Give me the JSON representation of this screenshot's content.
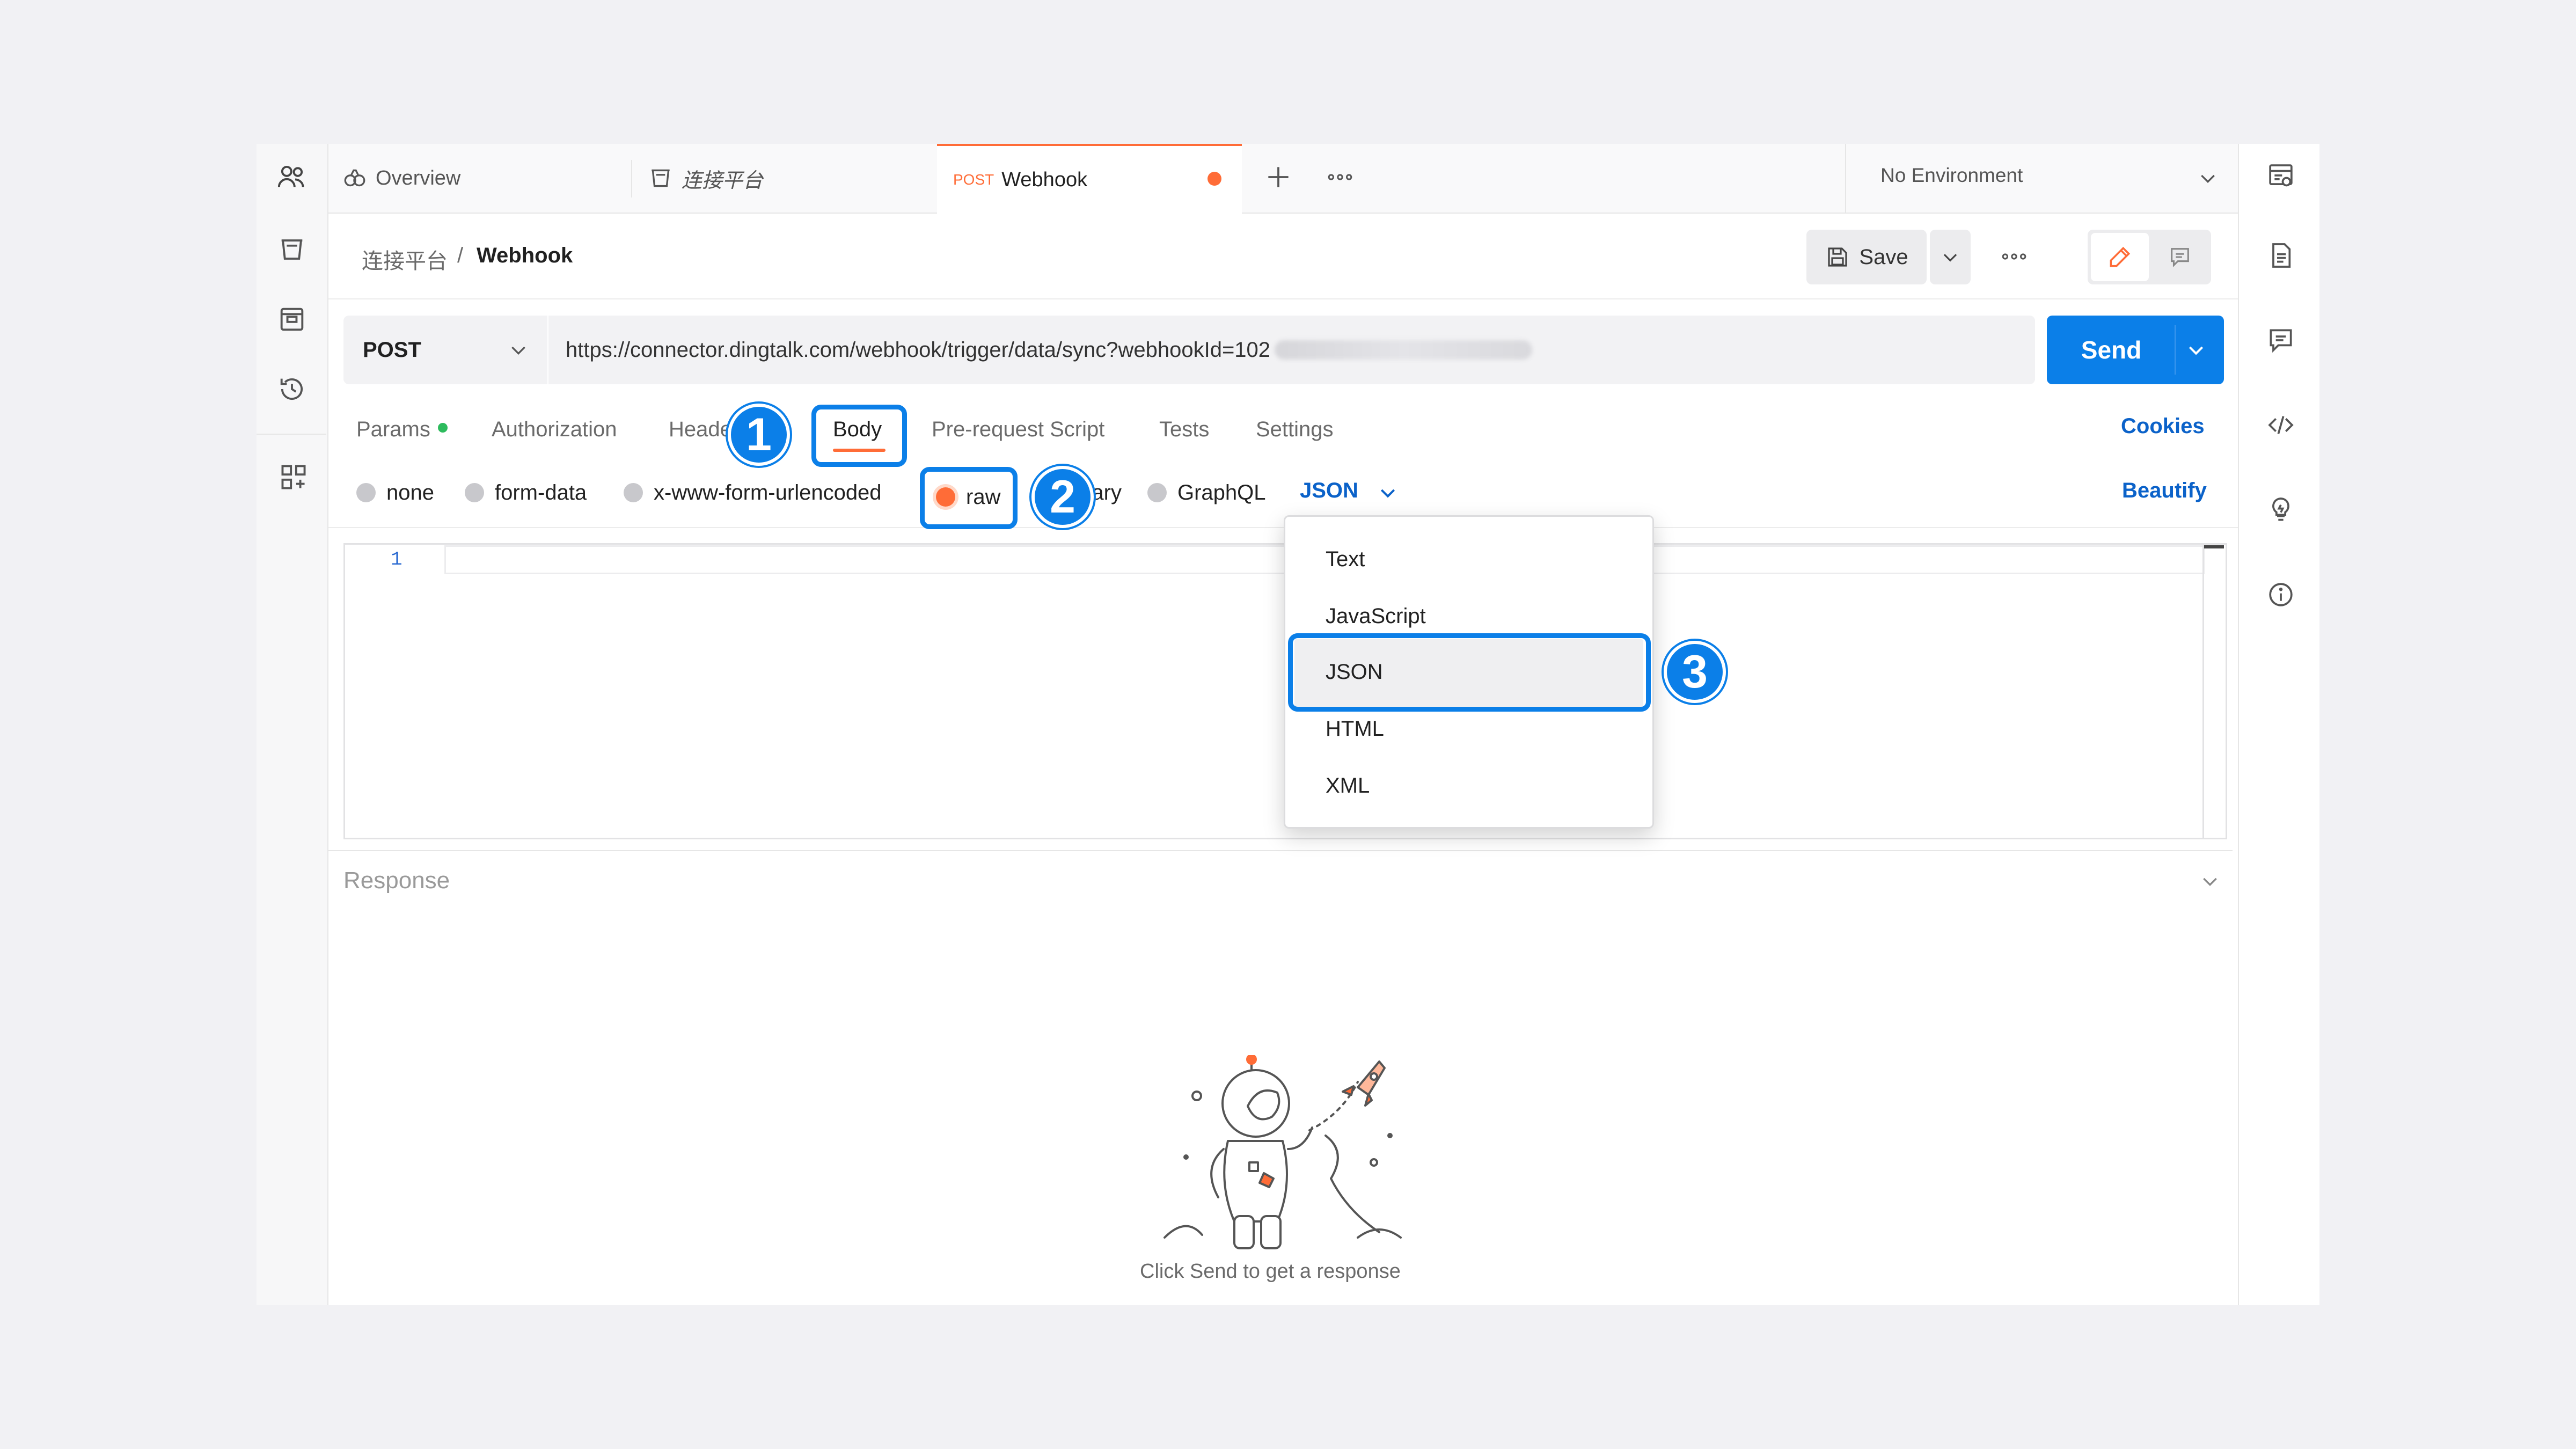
{
  "tabs": {
    "overview": "Overview",
    "platform": "连接平台",
    "active_method": "POST",
    "active_name": "Webhook"
  },
  "environment": {
    "label": "No Environment"
  },
  "breadcrumb": {
    "parent": "连接平台",
    "separator": "/",
    "current": "Webhook"
  },
  "toolbar": {
    "save_label": "Save"
  },
  "request": {
    "method": "POST",
    "url": "https://connector.dingtalk.com/webhook/trigger/data/sync?webhookId=102",
    "send_label": "Send"
  },
  "request_tabs": [
    "Params",
    "Authorization",
    "Headers",
    "Body",
    "Pre-request Script",
    "Tests",
    "Settings"
  ],
  "cookies_label": "Cookies",
  "body_types": [
    "none",
    "form-data",
    "x-www-form-urlencoded",
    "raw",
    "binary",
    "GraphQL"
  ],
  "body_format": "JSON",
  "beautify_label": "Beautify",
  "editor": {
    "line_number": "1"
  },
  "format_menu": [
    "Text",
    "JavaScript",
    "JSON",
    "HTML",
    "XML"
  ],
  "response": {
    "title": "Response",
    "empty_message": "Click Send to get a response"
  },
  "callouts": [
    "1",
    "2",
    "3"
  ],
  "colors": {
    "accent": "#0b7fe8",
    "postman_orange": "#ff6c37",
    "params_dot": "#2dbb5d"
  }
}
